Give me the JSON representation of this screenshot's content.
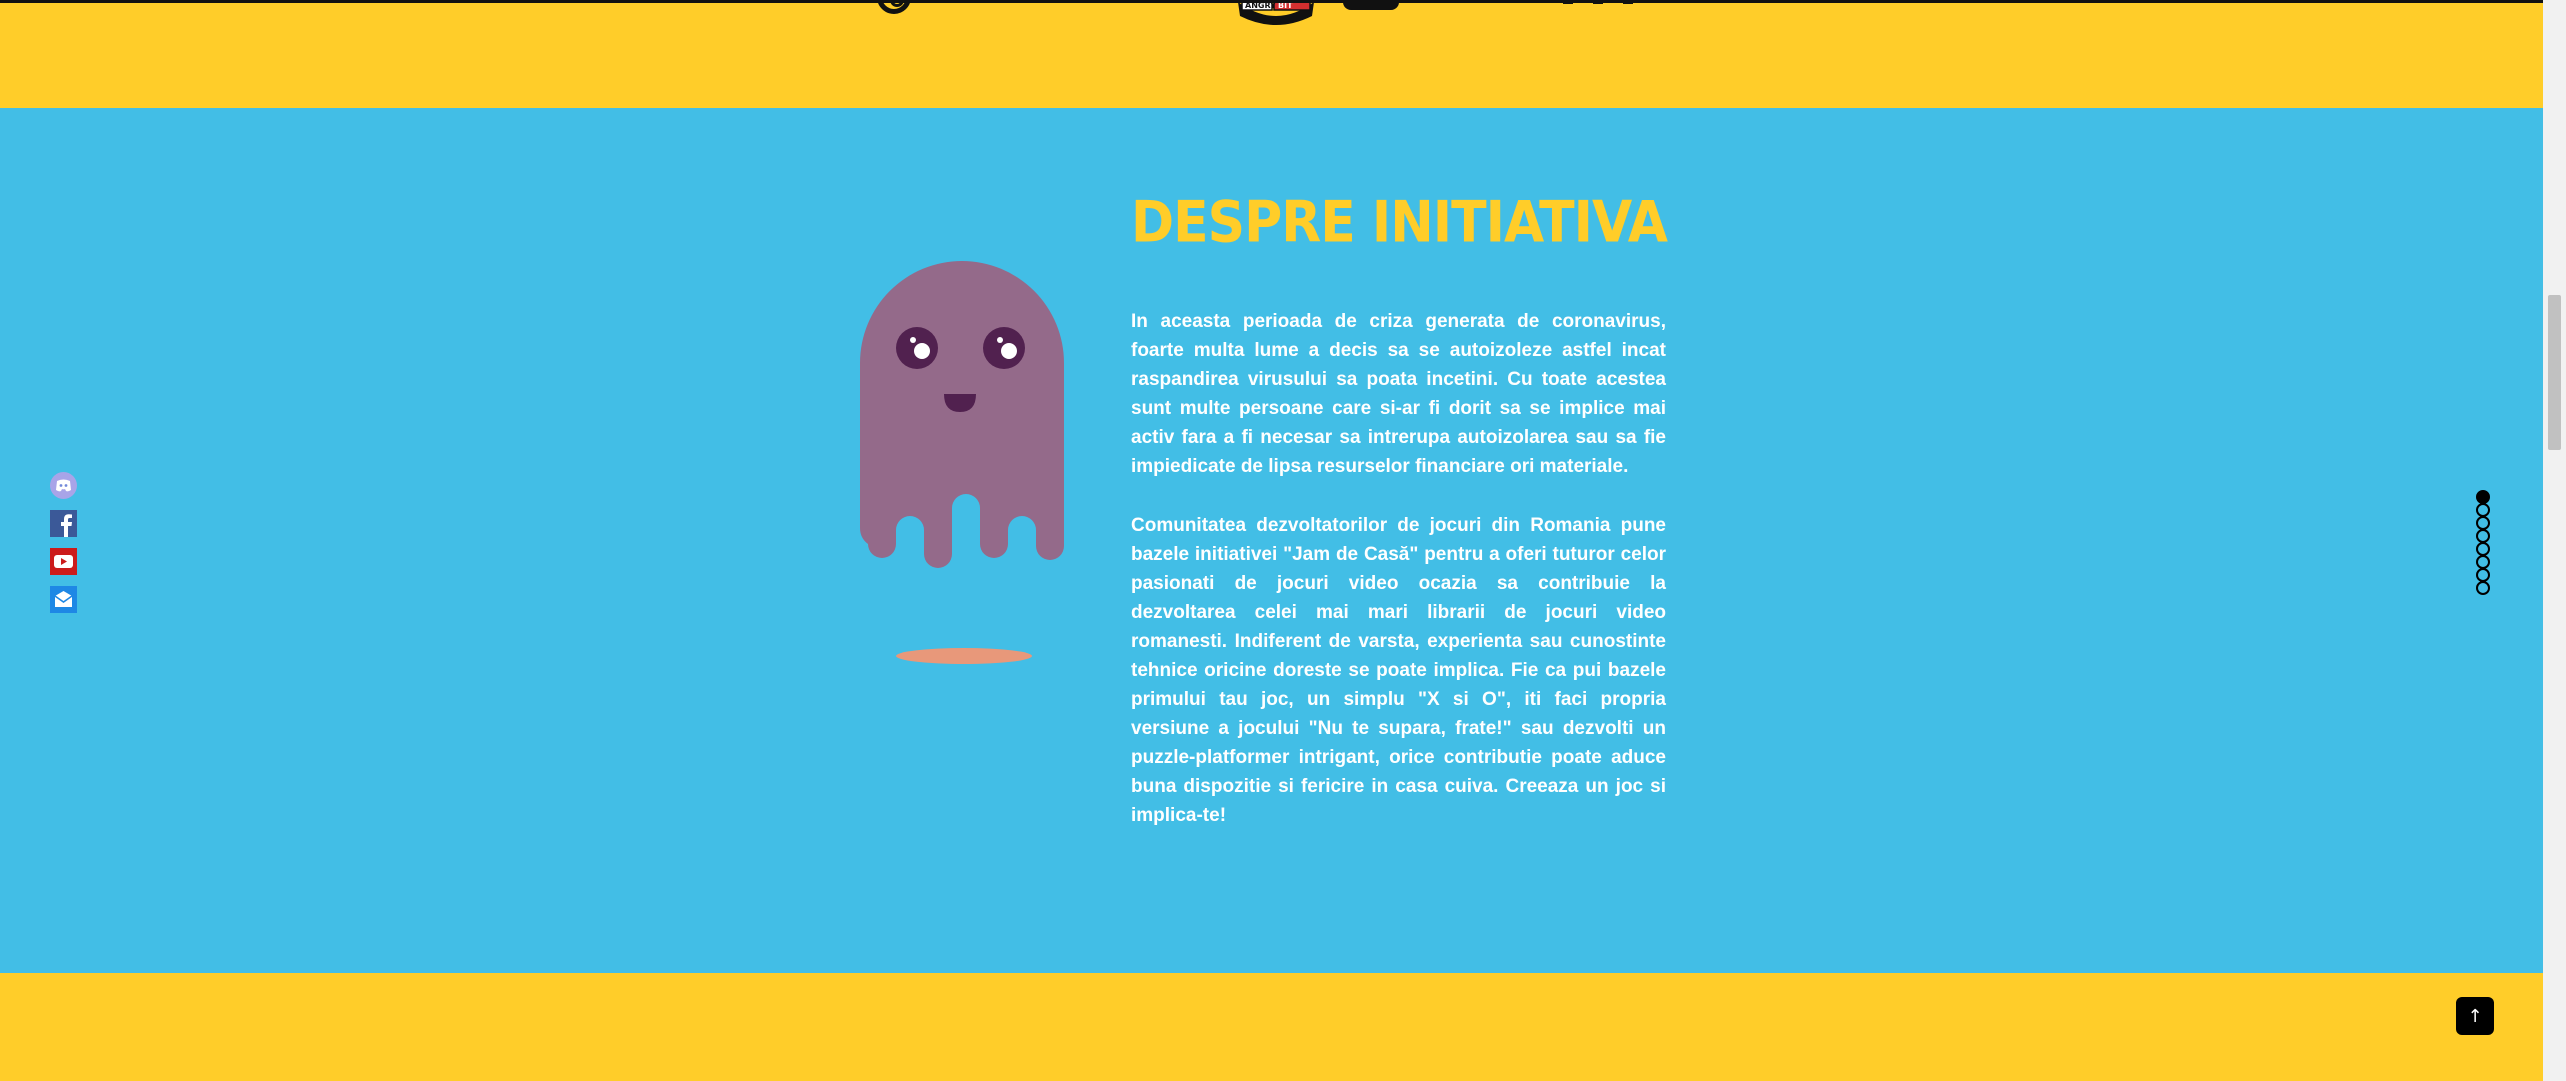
{
  "colors": {
    "yellow": "#ffcd29",
    "blue": "#42bee6",
    "ghost": "#946a8a",
    "ghost_eyes": "#51214f",
    "shadow": "#e8987a",
    "title": "#ffcd29",
    "text": "#ffffff"
  },
  "header": {
    "logos": [
      "controller-logo",
      "angry-bit-logo",
      "gamepad-logo",
      "pixel-logo"
    ]
  },
  "about": {
    "title": "DESPRE INITIATIVA",
    "paragraph1": "In aceasta perioada de criza generata de coronavirus, foarte multa lume a decis sa se autoizoleze astfel incat raspandirea virusului sa poata incetini. Cu toate acestea sunt multe persoane care si-ar fi dorit sa se implice mai activ fara a fi necesar sa intrerupa autoizolarea sau sa fie impiedicate de lipsa resurselor financiare ori materiale.",
    "paragraph2": "Comunitatea dezvoltatorilor de jocuri din Romania pune bazele initiativei \"Jam de Casă\" pentru a oferi tuturor celor pasionati de jocuri video ocazia sa contribuie la dezvoltarea celei mai mari librarii de jocuri video romanesti. Indiferent de varsta, experienta sau cunostinte tehnice oricine doreste se poate implica. Fie ca pui bazele primului tau joc, un simplu \"X si O\", iti faci propria versiune a jocului \"Nu te supara, frate!\" sau dezvolti un puzzle-platformer intrigant, orice contributie poate aduce buna dispozitie si fericire in casa cuiva. Creeaza un joc si implica-te!"
  },
  "socials": [
    {
      "name": "discord-icon",
      "color": "#7289da"
    },
    {
      "name": "facebook-icon",
      "color": "#3b5998"
    },
    {
      "name": "youtube-icon",
      "color": "#e62117"
    },
    {
      "name": "email-icon",
      "color": "#1e88e5"
    }
  ],
  "section_nav": {
    "count": 8,
    "active_index": 0
  },
  "back_to_top": {
    "icon": "arrow-up-icon",
    "glyph": "↑"
  }
}
